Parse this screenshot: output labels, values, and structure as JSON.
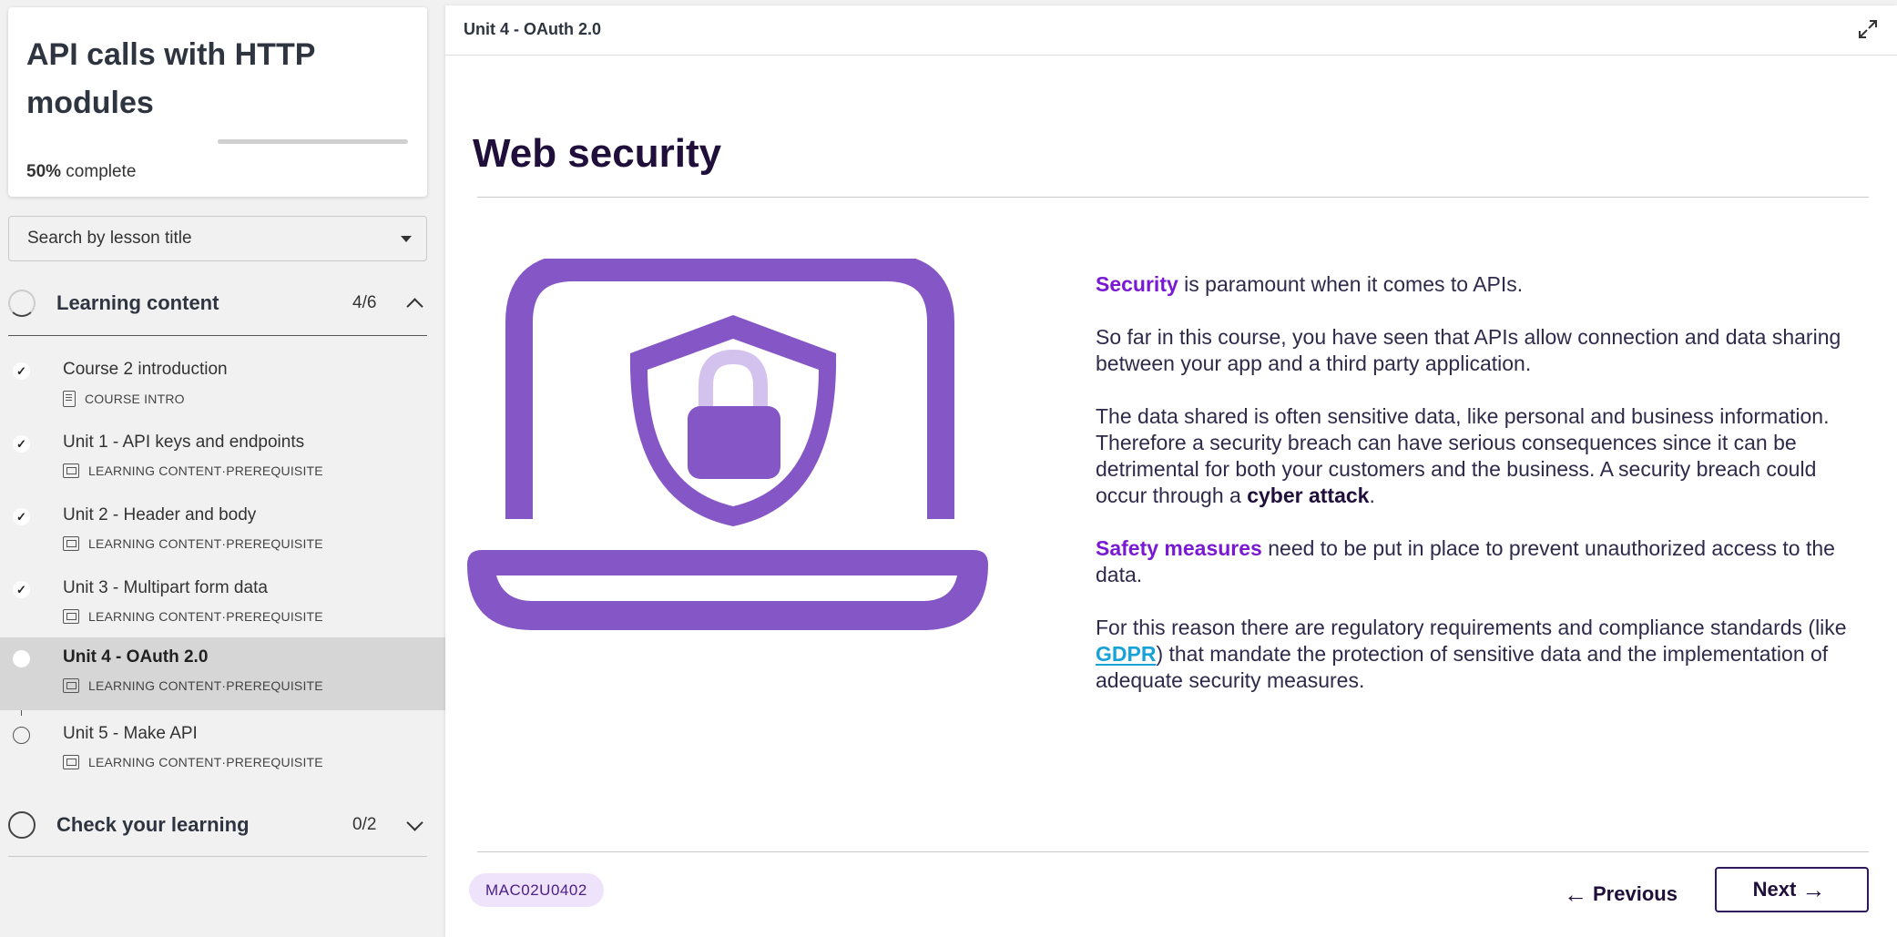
{
  "course": {
    "title": "API calls with HTTP modules",
    "progress_value": 0.5,
    "progress_percent": "50%",
    "progress_suffix": " complete"
  },
  "search": {
    "label": "Search by lesson title"
  },
  "learning_section": {
    "label": "Learning content",
    "count": "4/6",
    "lessons": [
      {
        "title": "Course 2 introduction",
        "type": "COURSE INTRO",
        "tag": "",
        "status": "done"
      },
      {
        "title": "Unit 1 - API keys and endpoints",
        "type": "LEARNING CONTENT",
        "tag": "PREREQUISITE",
        "status": "done"
      },
      {
        "title": "Unit 2 - Header and body",
        "type": "LEARNING CONTENT",
        "tag": "PREREQUISITE",
        "status": "done"
      },
      {
        "title": "Unit 3 - Multipart form data",
        "type": "LEARNING CONTENT",
        "tag": "PREREQUISITE",
        "status": "done"
      },
      {
        "title": "Unit 4 - OAuth 2.0",
        "type": "LEARNING CONTENT",
        "tag": "PREREQUISITE",
        "status": "current"
      },
      {
        "title": "Unit 5 - Make API",
        "type": "LEARNING CONTENT",
        "tag": "PREREQUISITE",
        "status": "open"
      }
    ],
    "separator": " · "
  },
  "check_section": {
    "label": "Check your learning",
    "count": "0/2"
  },
  "topbar": {
    "unit_title": "Unit 4 - OAuth 2.0"
  },
  "content": {
    "title": "Web security",
    "p1_hl": "Security",
    "p1_rest": " is paramount when it comes to APIs.",
    "p2": "So far in this course, you have seen that APIs allow connection and data sharing between your app and a third party application.",
    "p3_start": "The data shared is often sensitive data, like personal and business information. Therefore a security breach can have serious consequences since it can be detrimental for both your customers and the business. A security breach could occur through a ",
    "p3_strong": "cyber attack",
    "p3_end": ".",
    "p4_hl": "Safety measures",
    "p4_rest": " need to be put in place to prevent unauthorized access to the data.",
    "p5_start": "For this reason there are regulatory requirements and compliance standards (like ",
    "p5_link": "GDPR",
    "p5_end": ") that mandate the protection of sensitive data and the implementation of adequate security measures."
  },
  "footer": {
    "code": "MAC02U0402",
    "prev_label": "Previous",
    "next_label": "Next",
    "prev_arrow": "←",
    "next_arrow": "→"
  },
  "colors": {
    "accent": "#7a19d3",
    "illustration": "#8456c6",
    "illustration_light": "#d4c2ee",
    "link": "#17a2d8",
    "badge_bg": "#efe2fb"
  },
  "icons": {
    "expand": "expand-icon",
    "check": "✓"
  }
}
